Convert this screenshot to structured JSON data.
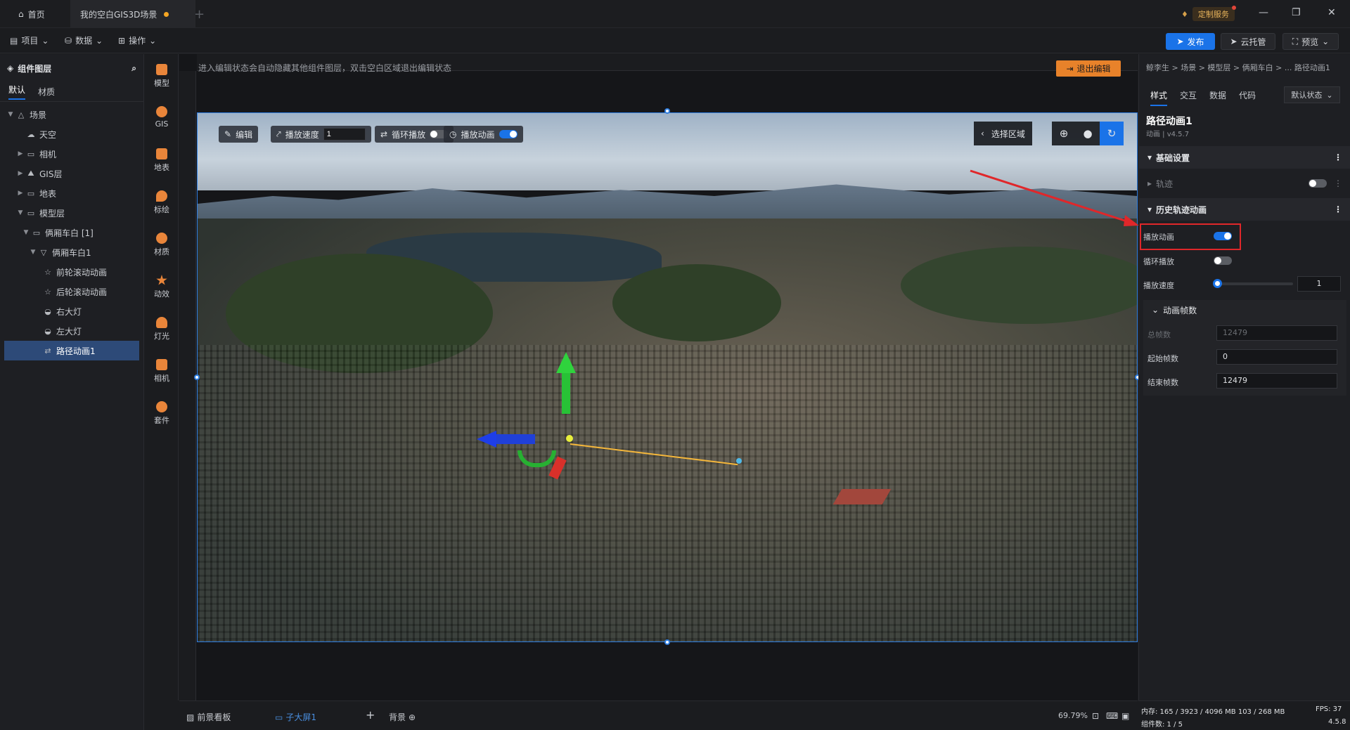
{
  "titlebar": {
    "home_tab": "首页",
    "active_tab": "我的空白GIS3D场景",
    "service_label": "定制服务"
  },
  "menubar": {
    "items": [
      "项目",
      "数据",
      "操作"
    ],
    "publish": "发布",
    "cloud": "云托管",
    "preview": "预览"
  },
  "left_panel": {
    "title": "组件图层",
    "tabs": [
      "默认",
      "材质"
    ],
    "tree": [
      {
        "label": "场景",
        "icon": "scene-icon"
      },
      {
        "label": "天空",
        "icon": "sky-icon"
      },
      {
        "label": "相机",
        "icon": "folder-icon"
      },
      {
        "label": "GIS层",
        "icon": "gis-icon"
      },
      {
        "label": "地表",
        "icon": "folder-icon"
      },
      {
        "label": "模型层",
        "icon": "folder-icon"
      },
      {
        "label": "俩厢车白 [1]",
        "icon": "folder-icon"
      },
      {
        "label": "俩厢车白1",
        "icon": "model-icon"
      },
      {
        "label": "前轮滚动动画",
        "icon": "star-icon"
      },
      {
        "label": "后轮滚动动画",
        "icon": "star-icon"
      },
      {
        "label": "右大灯",
        "icon": "light-icon"
      },
      {
        "label": "左大灯",
        "icon": "light-icon"
      },
      {
        "label": "路径动画1",
        "icon": "path-icon"
      }
    ]
  },
  "tools": [
    "模型",
    "GIS",
    "地表",
    "标绘",
    "材质",
    "动效",
    "灯光",
    "相机",
    "套件"
  ],
  "canvas": {
    "hint": "进入编辑状态会自动隐藏其他组件图层，双击空白区域退出编辑状态",
    "exit_button": "退出编辑",
    "toolbar": {
      "edit": "编辑",
      "play_speed": "播放速度",
      "play_speed_value": "1",
      "loop": "循环播放",
      "play_anim": "播放动画",
      "select_area": "选择区域"
    }
  },
  "bottombar": {
    "foreground": "前景看板",
    "subscreen": "子大屏1",
    "background": "背景",
    "zoom": "69.79%"
  },
  "right_panel": {
    "breadcrumb": "鲸李生 > 场景 > 模型层 > 俩厢车白 > ... 路径动画1",
    "tabs": [
      "样式",
      "交互",
      "数据",
      "代码"
    ],
    "state": "默认状态",
    "node_title": "路径动画1",
    "node_subtitle": "动画 | v4.5.7",
    "sections": {
      "basic": "基础设置",
      "track": "轨迹",
      "history": "历史轨迹动画",
      "frames": "动画帧数"
    },
    "props": {
      "play_anim": "播放动画",
      "loop": "循环播放",
      "speed": "播放速度",
      "speed_value": "1",
      "total_frames_label": "总帧数",
      "total_frames": "12479",
      "start_frame_label": "起始帧数",
      "start_frame": "0",
      "end_frame_label": "结束帧数",
      "end_frame": "12479"
    },
    "stats": {
      "memory": "内存:  165 / 3923 / 4096 MB  103 / 268 MB",
      "fps": "FPS:  37",
      "components": "组件数: 1 / 5",
      "version": "4.5.8"
    }
  },
  "colors": {
    "accent": "#1a73e8",
    "orange": "#e8822a",
    "highlight_box": "#e0272a"
  }
}
